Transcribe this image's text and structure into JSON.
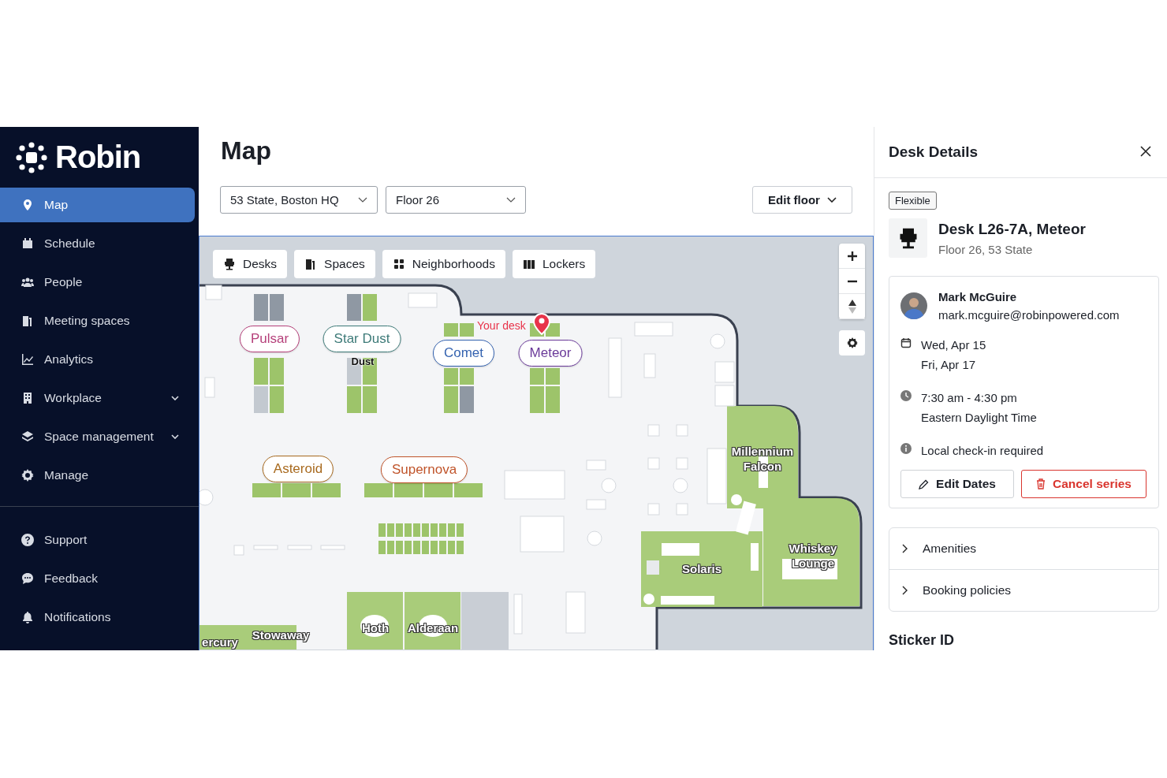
{
  "sidebar": {
    "logo": "Robin",
    "items": [
      {
        "label": "Map",
        "selected": true,
        "expandable": false
      },
      {
        "label": "Schedule",
        "selected": false,
        "expandable": false
      },
      {
        "label": "People",
        "selected": false,
        "expandable": false
      },
      {
        "label": "Meeting spaces",
        "selected": false,
        "expandable": false
      },
      {
        "label": "Analytics",
        "selected": false,
        "expandable": false
      },
      {
        "label": "Workplace",
        "selected": false,
        "expandable": true
      },
      {
        "label": "Space management",
        "selected": false,
        "expandable": true
      },
      {
        "label": "Manage",
        "selected": false,
        "expandable": false
      }
    ],
    "footer_items": [
      {
        "label": "Support"
      },
      {
        "label": "Feedback"
      },
      {
        "label": "Notifications"
      }
    ]
  },
  "header": {
    "title": "Map",
    "location": "53 State, Boston HQ",
    "floor": "Floor 26",
    "edit_button": "Edit floor"
  },
  "map": {
    "filters": [
      "Desks",
      "Spaces",
      "Neighborhoods",
      "Lockers"
    ],
    "neighborhoods": [
      {
        "label": "Pulsar",
        "color": "#b5407a"
      },
      {
        "label": "Star Dust",
        "color": "#3d7a78"
      },
      {
        "label": "Comet",
        "color": "#3563b0"
      },
      {
        "label": "Meteor",
        "color": "#6a3a99"
      },
      {
        "label": "Asteroid",
        "color": "#a86a1f"
      },
      {
        "label": "Supernova",
        "color": "#c0542a"
      }
    ],
    "desk_label": "Dust",
    "your_desk_label": "Your desk",
    "rooms": [
      "Millennium Falcon",
      "Solaris",
      "Whiskey Lounge",
      "Hoth",
      "Alderaan",
      "Stowaway",
      "ercury"
    ]
  },
  "details": {
    "title": "Desk Details",
    "tag": "Flexible",
    "desk_name": "Desk L26-7A, Meteor",
    "location": "Floor 26, 53 State",
    "person": {
      "name": "Mark McGuire",
      "email": "mark.mcguire@robinpowered.com"
    },
    "dates": [
      "Wed, Apr 15",
      "Fri, Apr 17"
    ],
    "time": "7:30 am - 4:30 pm",
    "timezone": "Eastern Daylight Time",
    "check_in": "Local check-in required",
    "buttons": [
      {
        "label": "Edit Dates",
        "kind": "secondary"
      },
      {
        "label": "Cancel series",
        "kind": "danger"
      }
    ],
    "sections": [
      {
        "label": "Amenities",
        "expanded": false
      },
      {
        "label": "Booking policies",
        "expanded": false
      }
    ],
    "sticker_heading": "Sticker ID"
  }
}
